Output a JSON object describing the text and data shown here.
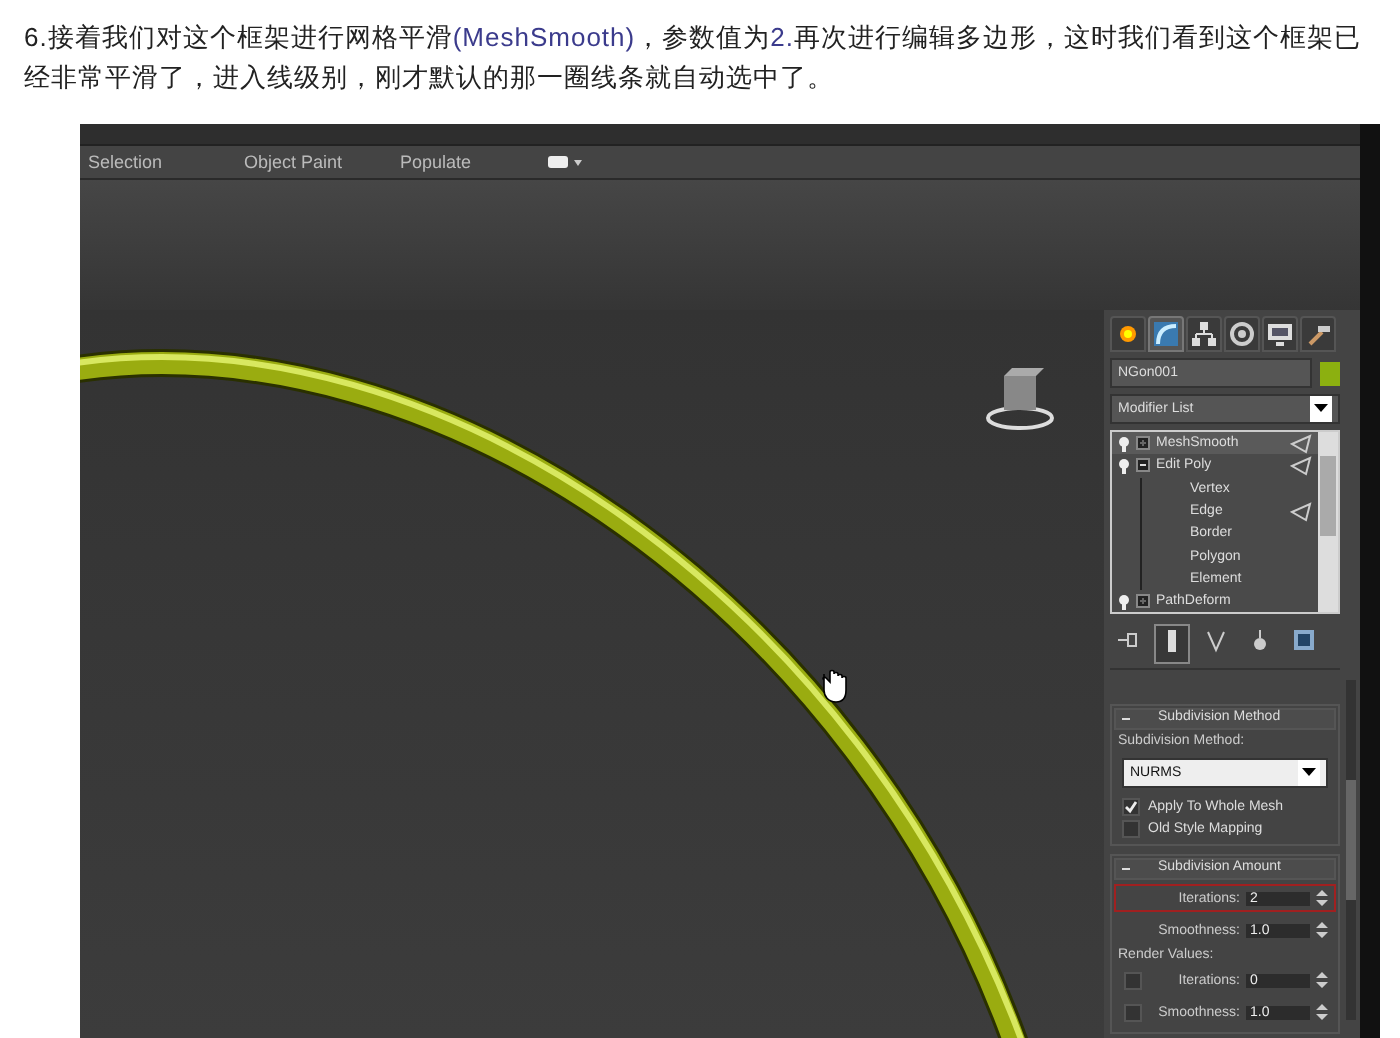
{
  "instruction": {
    "segments": [
      {
        "kind": "plain",
        "text": "6.接着我们对这个框架进行网格平滑"
      },
      {
        "kind": "latin",
        "text": "(MeshSmooth)"
      },
      {
        "kind": "plain",
        "text": "，参数值为"
      },
      {
        "kind": "latin",
        "text": "2."
      },
      {
        "kind": "plain",
        "text": "再次进行编辑多边形，这时我们看到这个框架已经非常平滑了，进入线级别，刚才默认的那一圈线条就自动选中了。"
      }
    ]
  },
  "screenshot": {
    "ribbon_tabs": [
      "Selection",
      "Object Paint",
      "Populate"
    ],
    "command_panel": {
      "tabs": [
        {
          "kind": "create",
          "selected": false
        },
        {
          "kind": "modify",
          "selected": true
        },
        {
          "kind": "hierarchy",
          "selected": false
        },
        {
          "kind": "motion",
          "selected": false
        },
        {
          "kind": "display",
          "selected": false
        },
        {
          "kind": "utilities",
          "selected": false
        }
      ],
      "object_name": "NGon001",
      "modifier_list": "Modifier List",
      "stack": [
        {
          "label": "MeshSmooth",
          "selected": true,
          "expanded": false,
          "marked": true
        },
        {
          "label": "Edit Poly",
          "selected": false,
          "expanded": true,
          "marked": true,
          "children": [
            {
              "label": "Vertex",
              "marked": false
            },
            {
              "label": "Edge",
              "marked": true
            },
            {
              "label": "Border",
              "marked": false
            },
            {
              "label": "Polygon",
              "marked": false
            },
            {
              "label": "Element",
              "marked": false
            }
          ]
        },
        {
          "label": "PathDeform",
          "selected": false,
          "expanded": false,
          "marked": false
        }
      ],
      "rollouts": [
        {
          "title": "Subdivision Method",
          "controls": [
            {
              "kind": "label",
              "text": "Subdivision Method:"
            },
            {
              "kind": "dropdown",
              "value": "NURMS"
            },
            {
              "kind": "checkbox",
              "label": "Apply To Whole Mesh",
              "checked": true
            },
            {
              "kind": "checkbox",
              "label": "Old Style Mapping",
              "checked": false
            }
          ]
        },
        {
          "title": "Subdivision Amount",
          "controls": [
            {
              "kind": "spinner",
              "label": "Iterations:",
              "value": "2",
              "highlighted": true
            },
            {
              "kind": "spinner",
              "label": "Smoothness:",
              "value": "1.0",
              "highlighted": false
            },
            {
              "kind": "label",
              "text": "Render Values:"
            },
            {
              "kind": "check-spinner",
              "label": "Iterations:",
              "value": "0",
              "checked": false
            },
            {
              "kind": "check-spinner",
              "label": "Smoothness:",
              "value": "1.0",
              "checked": false
            }
          ]
        }
      ]
    }
  }
}
